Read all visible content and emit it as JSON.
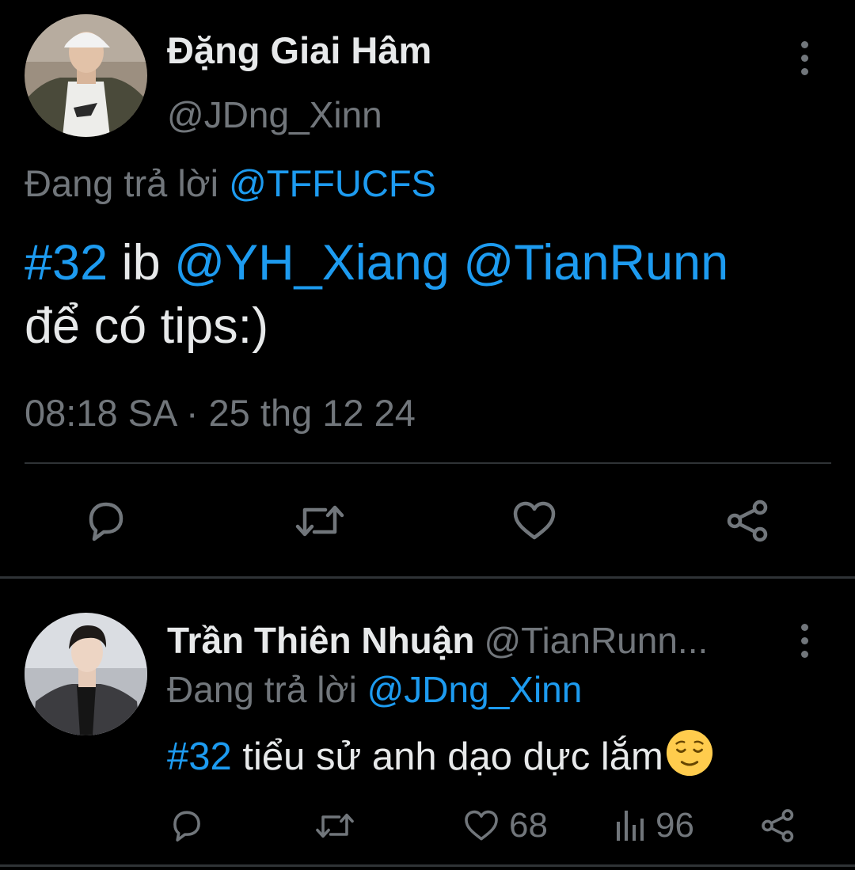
{
  "main_tweet": {
    "display_name": "Đặng Giai Hâm",
    "handle": "@JDng_Xinn",
    "replying_prefix": "Đang trả lời",
    "replying_to": "@TFFUCFS",
    "text_hashtag": "#32",
    "text_part1": " ib ",
    "mention1": "@YH_Xiang",
    "text_space": " ",
    "mention2": "@TianRunn",
    "text_part2": "để có tips:)",
    "timestamp": "08:18 SA · 25 thg 12 24",
    "actions": [
      "reply-icon",
      "retweet-icon",
      "like-icon",
      "share-icon"
    ]
  },
  "reply_tweet": {
    "display_name": "Trần Thiên Nhuận",
    "handle": "@TianRunn...",
    "replying_prefix": "Đang trả lời",
    "replying_to": "@JDng_Xinn",
    "text_hashtag": "#32",
    "text_body": " tiểu sử anh dạo dực lắm",
    "emoji": "relieved-face-emoji",
    "like_count": "68",
    "view_count": "96",
    "actions": [
      "reply-icon",
      "retweet-icon",
      "like-icon",
      "views-icon",
      "share-icon"
    ]
  },
  "colors": {
    "background": "#000000",
    "text_primary": "#E7E9EA",
    "text_secondary": "#71767B",
    "accent": "#1D9BF0",
    "divider": "#2F3336"
  }
}
